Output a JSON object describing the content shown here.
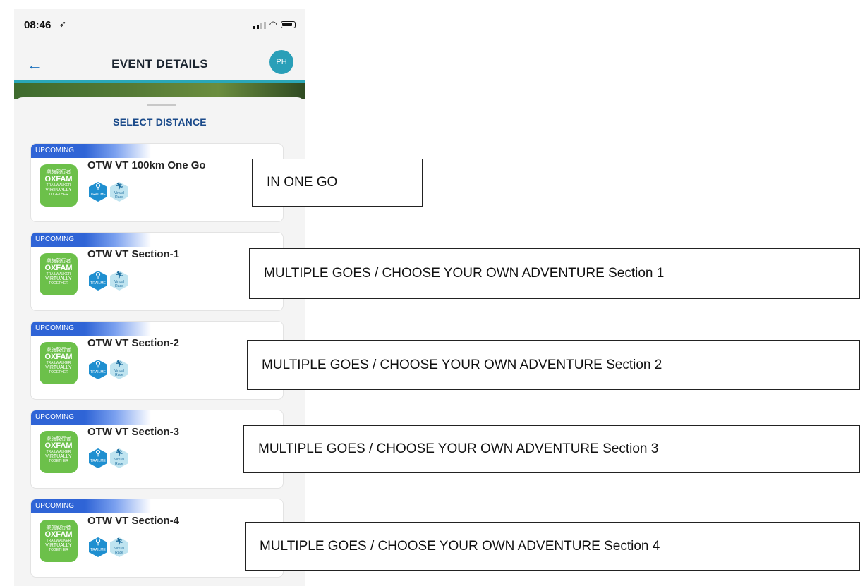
{
  "status_bar": {
    "time": "08:46",
    "location_icon": "location-arrow-icon"
  },
  "header": {
    "title": "EVENT DETAILS",
    "avatar_initials": "PH",
    "accent": "#2aa7b8"
  },
  "sheet": {
    "title": "SELECT DISTANCE"
  },
  "events": [
    {
      "status": "UPCOMING",
      "title": "OTW VT 100km One Go",
      "badges": [
        "TRAILME",
        "Virtual Race"
      ]
    },
    {
      "status": "UPCOMING",
      "title": "OTW VT Section-1",
      "badges": [
        "TRAILME",
        "Virtual Race"
      ]
    },
    {
      "status": "UPCOMING",
      "title": "OTW VT Section-2",
      "badges": [
        "TRAILME",
        "Virtual Race"
      ]
    },
    {
      "status": "UPCOMING",
      "title": "OTW VT Section-3",
      "badges": [
        "TRAILME",
        "Virtual Race"
      ]
    },
    {
      "status": "UPCOMING",
      "title": "OTW VT Section-4",
      "badges": [
        "TRAILME",
        "Virtual Race"
      ]
    }
  ],
  "logo": {
    "cn": "樂施毅行者",
    "oxfam": "OXFAM",
    "trailwalker": "TRAILWALKER",
    "virtually": "VIRTUALLY",
    "together": "TOGETHER"
  },
  "annotations": [
    "IN ONE GO",
    "MULTIPLE GOES / CHOOSE YOUR OWN ADVENTURE Section 1",
    "MULTIPLE GOES / CHOOSE YOUR OWN ADVENTURE Section 2",
    "MULTIPLE GOES / CHOOSE YOUR OWN ADVENTURE Section 3",
    "MULTIPLE GOES / CHOOSE YOUR OWN ADVENTURE Section 4"
  ]
}
